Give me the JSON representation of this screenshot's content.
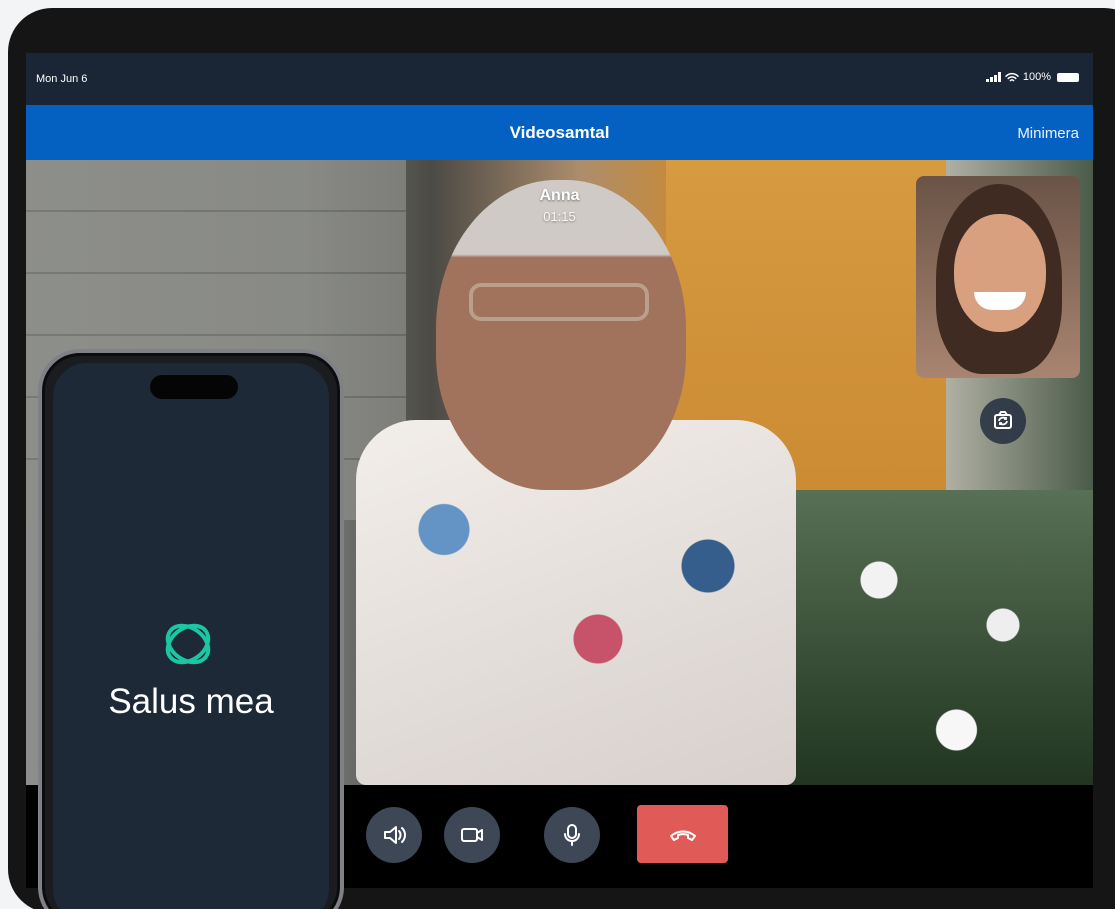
{
  "status_bar": {
    "date": "Mon Jun 6",
    "battery": "100%"
  },
  "navigation": {
    "title": "Videosamtal",
    "minimize_label": "Minimera"
  },
  "call": {
    "caller_name": "Anna",
    "duration": "01:15"
  },
  "phone_app": {
    "brand_name": "Salus mea"
  },
  "colors": {
    "header_blue": "#0461c2",
    "hangup_red": "#e05a57",
    "logo_teal": "#1bc6a2"
  },
  "icons": {
    "camera_switch": "camera-switch-icon",
    "speaker": "speaker-icon",
    "video": "video-camera-icon",
    "microphone": "microphone-icon",
    "hangup": "phone-hangup-icon"
  }
}
